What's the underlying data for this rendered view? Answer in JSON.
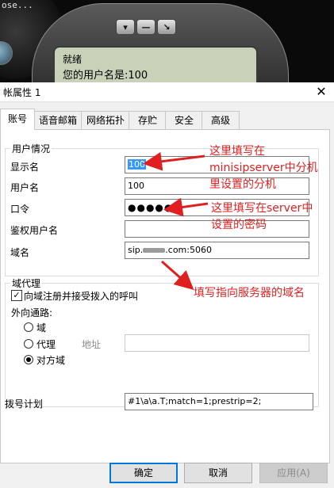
{
  "phone": {
    "caption": "ose...",
    "keys": [
      "▾",
      "—",
      "↘"
    ],
    "status": "就绪",
    "user_line": "您的用户名是:100"
  },
  "dialog": {
    "title": "帐属性 1",
    "close": "✕",
    "tabs": [
      "账号",
      "语音邮箱",
      "网络拓扑",
      "存贮",
      "安全",
      "高级"
    ],
    "user_info": {
      "group_label": "用户情况",
      "display_name_label": "显示名",
      "display_name_value": "100",
      "username_label": "用户名",
      "username_value": "100",
      "password_label": "口令",
      "password_value": "●●●●●●",
      "auth_user_label": "鉴权用户名",
      "auth_user_value": "",
      "domain_label": "域名",
      "domain_prefix": "sip.",
      "domain_suffix": ".com:5060"
    },
    "proxy": {
      "group_label": "域代理",
      "register_label": "向域注册并接受拨入的呼叫",
      "register_checked": true,
      "outbound_label": "外向通路:",
      "opt_domain": "域",
      "opt_proxy": "代理",
      "address_label": "地址",
      "address_value": "",
      "opt_peer": "对方域",
      "selected": "对方域"
    },
    "dial_plan": {
      "label": "拨号计划",
      "value": "#1\\a\\a.T;match=1;prestrip=2;"
    },
    "buttons": {
      "ok": "确定",
      "cancel": "取消",
      "apply": "应用(A)"
    }
  },
  "annotations": {
    "a1_line1": "这里填写在",
    "a1_line2": "minisipserver中分机",
    "a1_line3": "里设置的分机",
    "a2_line1": "这里填写在server中",
    "a2_line2": "设置的密码",
    "a3": "填写指向服务器的域名",
    "color": "#e02020"
  }
}
